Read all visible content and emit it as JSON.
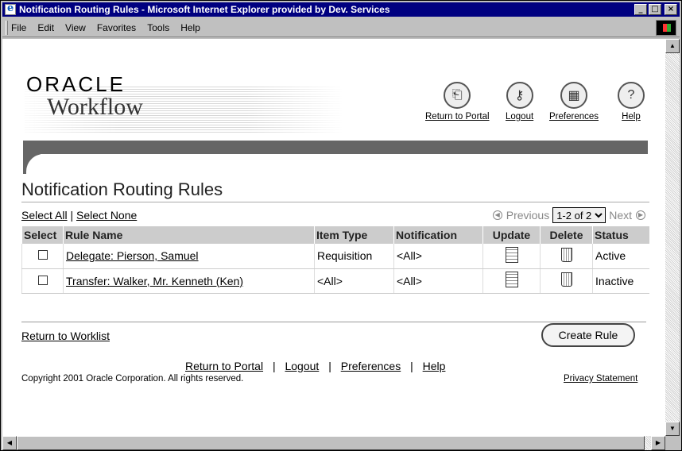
{
  "window": {
    "title": "Notification Routing Rules - Microsoft Internet Explorer provided by Dev. Services"
  },
  "menu": [
    "File",
    "Edit",
    "View",
    "Favorites",
    "Tools",
    "Help"
  ],
  "brand": {
    "oracle": "ORACLE",
    "product": "Workflow"
  },
  "global_links": {
    "return_to_portal": "Return to Portal",
    "logout": "Logout",
    "preferences": "Preferences",
    "help": "Help"
  },
  "page": {
    "title": "Notification Routing Rules"
  },
  "selection": {
    "select_all": "Select All",
    "separator": "|",
    "select_none": "Select None"
  },
  "pager": {
    "previous": "Previous",
    "range": "1-2 of 2",
    "next": "Next"
  },
  "table": {
    "headers": {
      "select": "Select",
      "rule_name": "Rule Name",
      "item_type": "Item Type",
      "notification": "Notification",
      "update": "Update",
      "delete": "Delete",
      "status": "Status"
    },
    "rows": [
      {
        "rule_name": "Delegate: Pierson, Samuel",
        "item_type": "Requisition",
        "notification": "<All>",
        "status": "Active"
      },
      {
        "rule_name": "Transfer: Walker, Mr. Kenneth (Ken)",
        "item_type": "<All>",
        "notification": "<All>",
        "status": "Inactive"
      }
    ]
  },
  "actions": {
    "return_to_worklist": "Return to Worklist",
    "create_rule": "Create Rule"
  },
  "footer": {
    "return_to_portal": "Return to Portal",
    "logout": "Logout",
    "preferences": "Preferences",
    "help": "Help",
    "separator": "|",
    "copyright": "Copyright 2001 Oracle Corporation. All rights reserved.",
    "privacy": "Privacy Statement"
  }
}
